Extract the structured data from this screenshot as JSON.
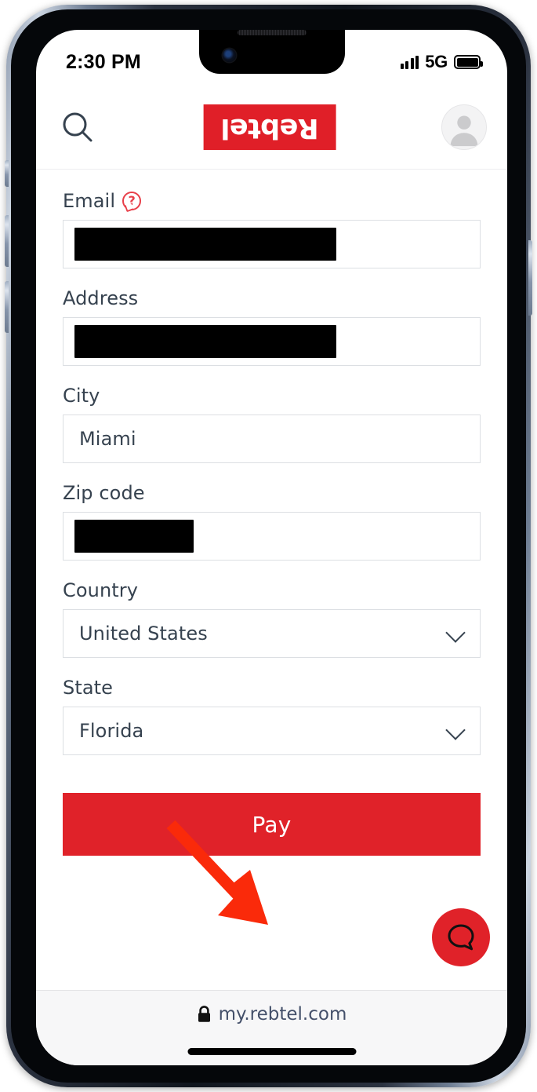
{
  "status_bar": {
    "time": "2:30 PM",
    "network_type": "5G",
    "signal_icon": "signal-bars-icon",
    "battery_icon": "battery-full-icon"
  },
  "header": {
    "search_icon": "search-icon",
    "logo_text": "Rebtel",
    "avatar_icon": "person-avatar-icon",
    "logo_bg_color": "#E01F28"
  },
  "form": {
    "fields": [
      {
        "label": "Email",
        "value": "",
        "redacted": true,
        "redaction_width": "68%",
        "type": "text",
        "has_help_icon": true,
        "help_icon": "question-mark-bubble-icon",
        "name": "email-field"
      },
      {
        "label": "Address",
        "value": "",
        "redacted": true,
        "redaction_width": "68%",
        "type": "text",
        "has_help_icon": false,
        "name": "address-field"
      },
      {
        "label": "City",
        "value": "Miami",
        "redacted": false,
        "type": "text",
        "has_help_icon": false,
        "name": "city-field"
      },
      {
        "label": "Zip code",
        "value": "",
        "redacted": true,
        "redaction_width": "31%",
        "type": "text",
        "has_help_icon": false,
        "name": "zip-code-field"
      },
      {
        "label": "Country",
        "value": "United States",
        "redacted": false,
        "type": "select",
        "has_help_icon": false,
        "name": "country-select"
      },
      {
        "label": "State",
        "value": "Florida",
        "redacted": false,
        "type": "select",
        "has_help_icon": false,
        "name": "state-select"
      }
    ],
    "pay_button_label": "Pay",
    "pay_button_color": "#E02229"
  },
  "chat_fab": {
    "icon": "chat-bubble-icon",
    "background_color": "#E02229"
  },
  "annotation": {
    "type": "arrow",
    "color": "#FA2A0A",
    "points_to": "pay-button"
  },
  "browser_bar": {
    "lock_icon": "lock-icon",
    "url": "my.rebtel.com"
  }
}
